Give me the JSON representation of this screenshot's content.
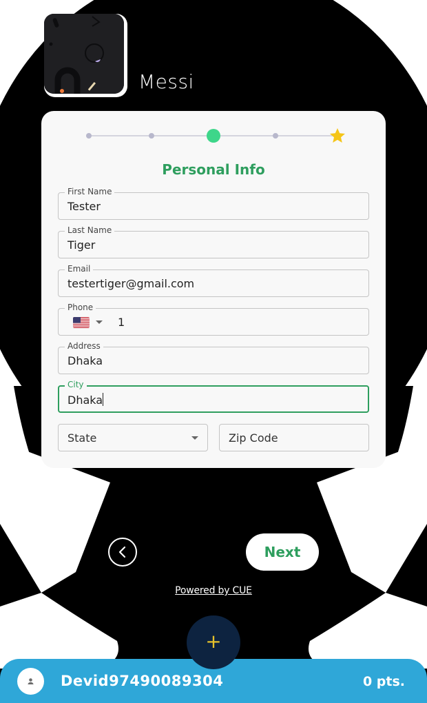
{
  "brand": {
    "name": "Messi"
  },
  "stepper": {
    "current_step": 3,
    "total_steps": 5,
    "active_color": "#3ed68a",
    "star_color": "#f5c518"
  },
  "form": {
    "title": "Personal Info",
    "first_name": {
      "label": "First Name",
      "value": "Tester"
    },
    "last_name": {
      "label": "Last Name",
      "value": "Tiger"
    },
    "email": {
      "label": "Email",
      "value": "testertiger@gmail.com"
    },
    "phone": {
      "label": "Phone",
      "country_icon": "us-flag-icon",
      "value": "1"
    },
    "address": {
      "label": "Address",
      "value": "Dhaka"
    },
    "city": {
      "label": "City",
      "value": "Dhaka"
    },
    "state": {
      "placeholder": "State"
    },
    "zip": {
      "placeholder": "Zip Code"
    }
  },
  "nav": {
    "back_icon": "chevron-left-icon",
    "next_label": "Next"
  },
  "footer": {
    "powered_by": "Powered by CUE"
  },
  "bottom_bar": {
    "username": "Devid97490089304",
    "points": "0 pts.",
    "accent_color": "#2fa7d8"
  },
  "fab": {
    "icon": "plus-icon",
    "label": "+"
  }
}
